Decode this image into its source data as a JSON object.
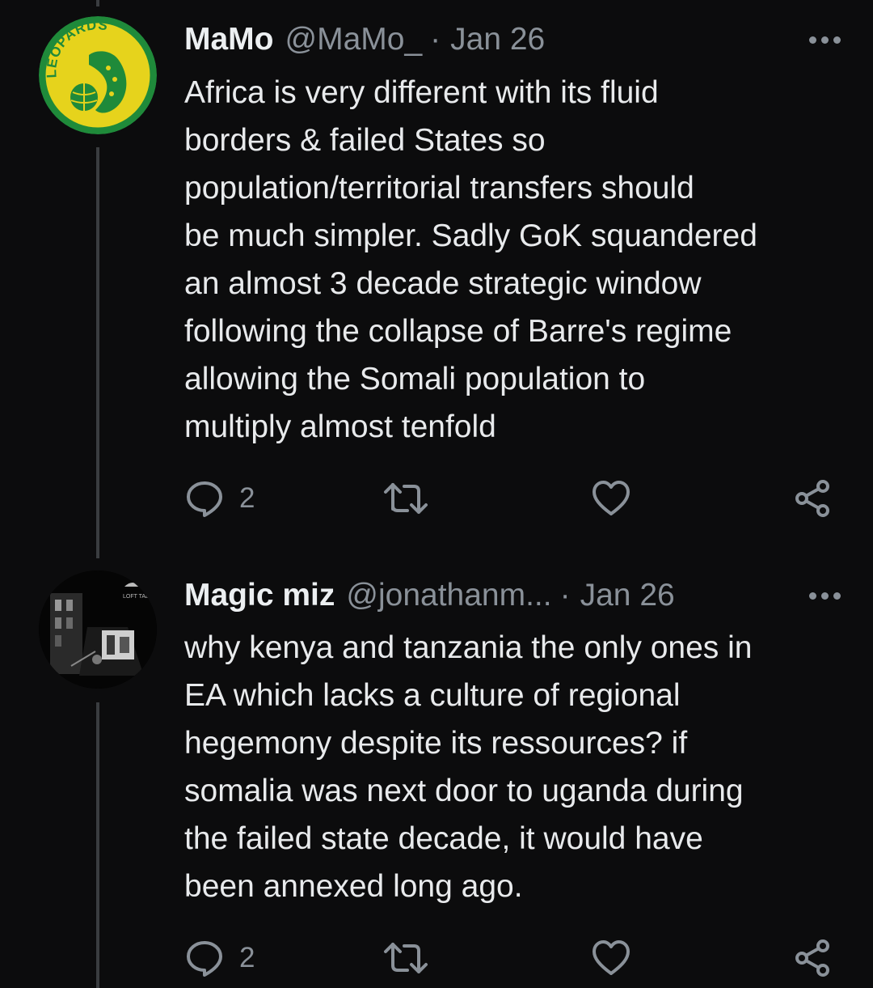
{
  "tweets": [
    {
      "name": "MaMo",
      "handle": "@MaMo_",
      "separator": "·",
      "date": "Jan 26",
      "avatar_text": "LEOPARDS",
      "text": "Africa is very different with its fluid\nborders & failed States so\npopulation/territorial transfers should\nbe much simpler. Sadly GoK squandered\nan almost 3 decade strategic window\nfollowing the collapse of Barre's regime\nallowing the Somali population to\nmultiply almost tenfold",
      "reply_count": "2"
    },
    {
      "name": "Magic miz",
      "handle": "@jonathanm...",
      "separator": "·",
      "date": "Jan 26",
      "avatar_text": "LOFT TALK",
      "text": "why kenya and tanzania the only ones in\nEA which lacks a culture of regional\nhegemony despite its ressources? if\nsomalia was next door to uganda during\nthe failed state decade, it would have\nbeen annexed long ago.",
      "reply_count": "2"
    }
  ],
  "icons": {
    "reply": "reply-icon",
    "retweet": "retweet-icon",
    "like": "heart-icon",
    "share": "share-icon",
    "more": "more-icon"
  },
  "colors": {
    "background": "#0c0c0d",
    "text": "#e8eaec",
    "secondary": "#8a9199",
    "thread_line": "#3a3d40",
    "avatar_green": "#1f8a3a",
    "avatar_yellow": "#e6d31c"
  }
}
